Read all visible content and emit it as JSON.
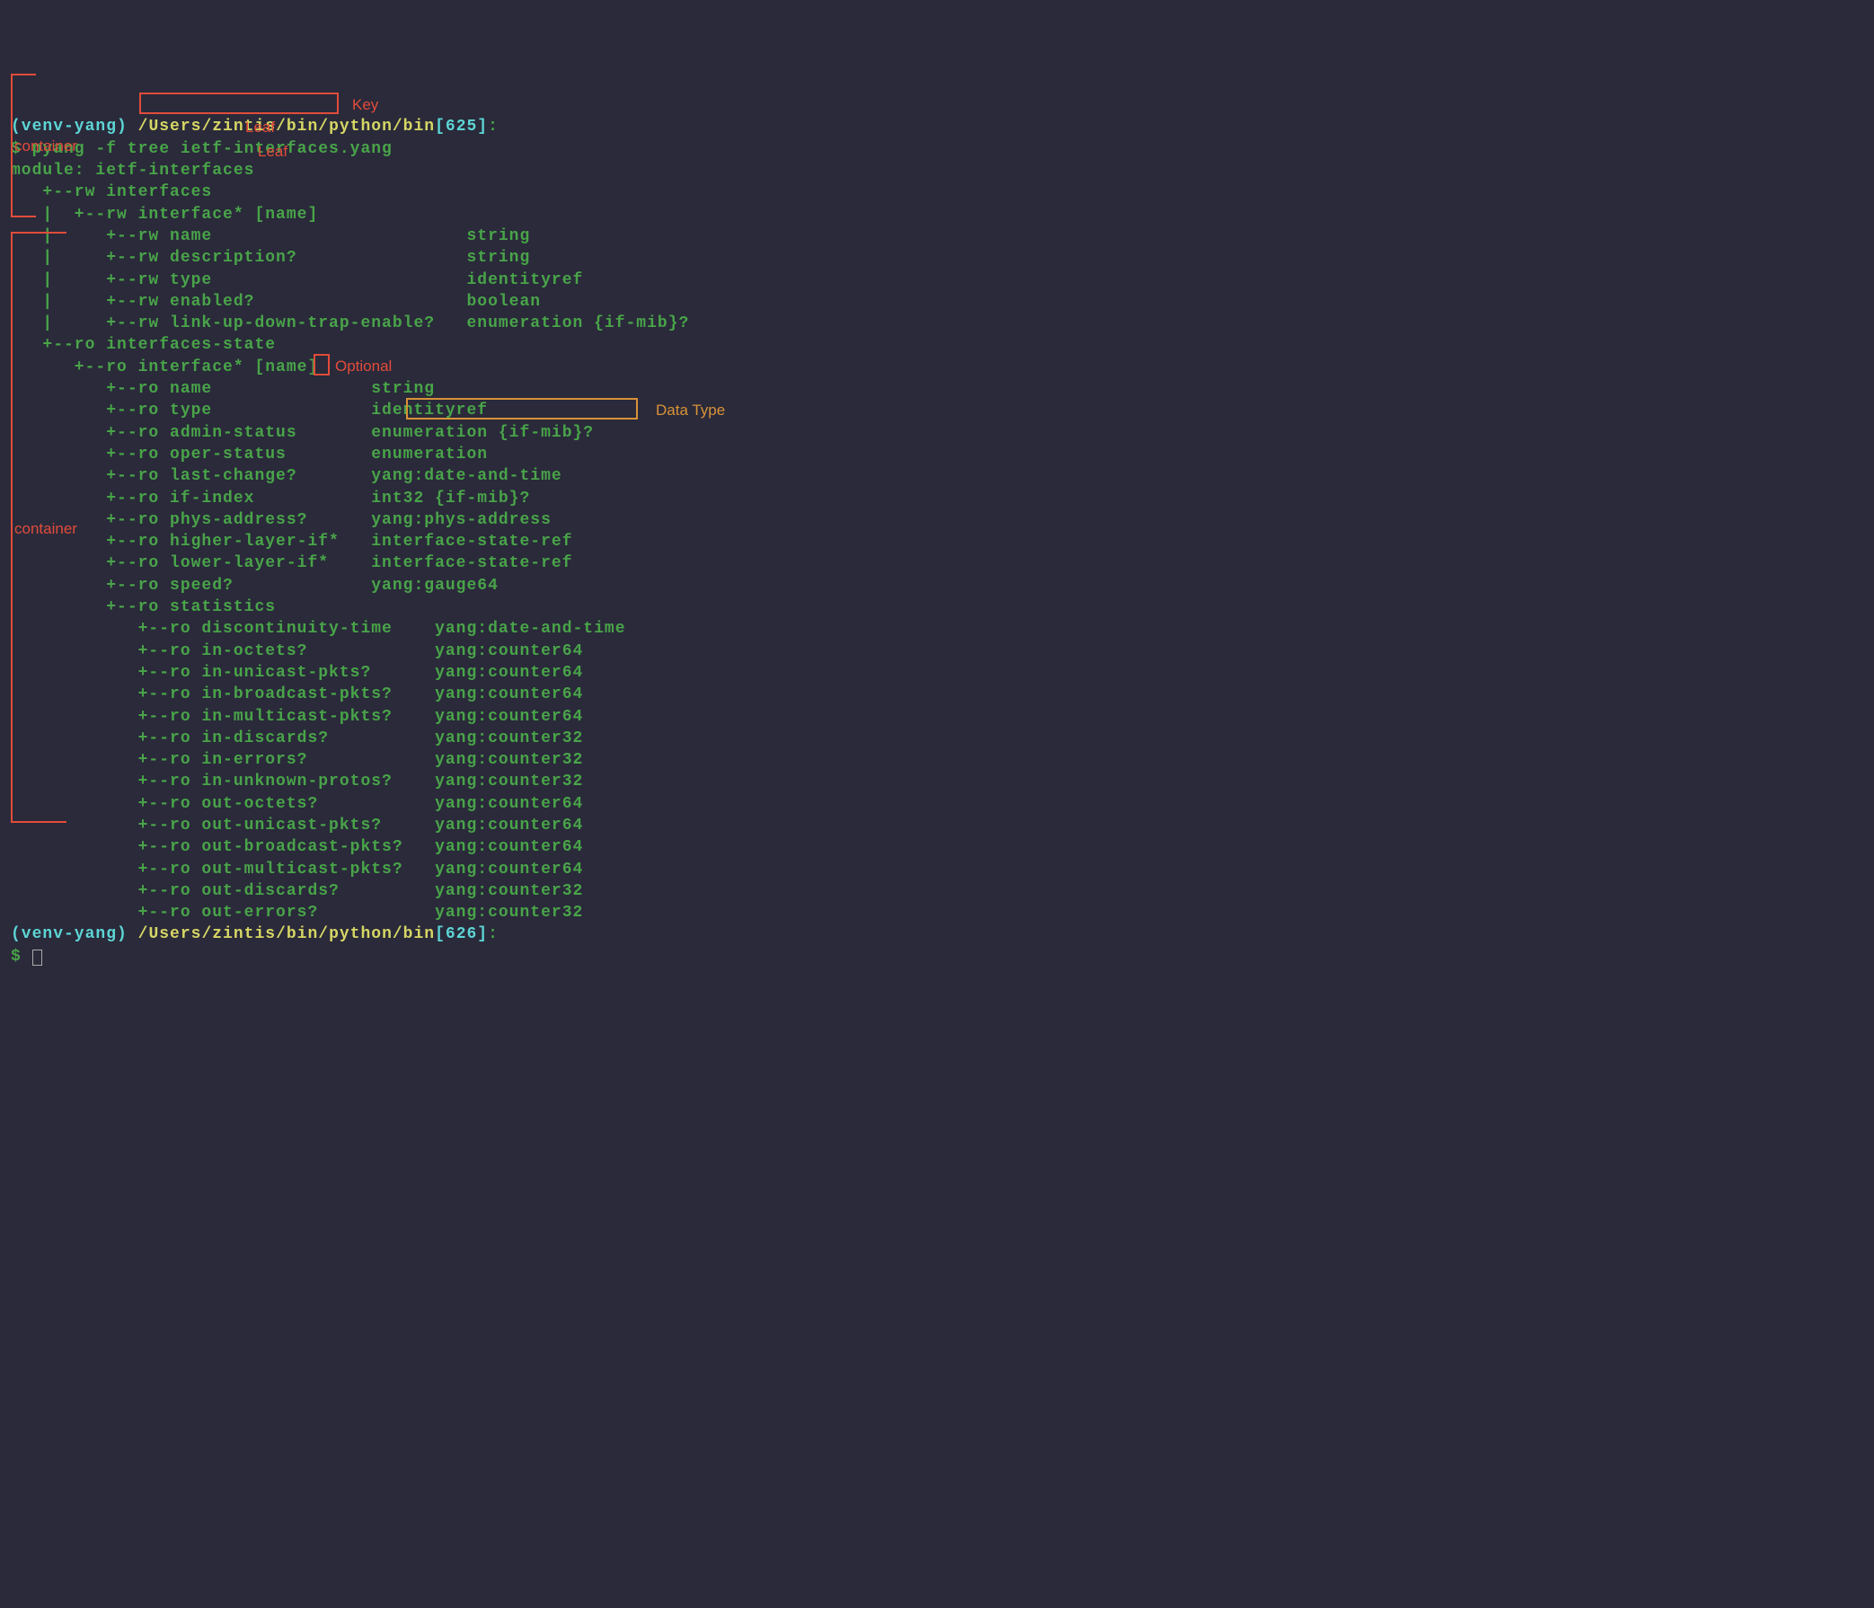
{
  "prompt1": {
    "venv": "(venv-yang)",
    "path": "/Users/zintis/bin/python/bin",
    "histnum": "[625]",
    "colon": ":"
  },
  "cmd1": "$ pyang -f tree ietf-interfaces.yang",
  "module_line": "module: ietf-interfaces",
  "tree1": {
    "l1": "   +--rw interfaces",
    "l2": "   |  +--rw interface* [name]",
    "l3": "   |     +--rw name                        string",
    "l4": "   |     +--rw description?                string",
    "l5": "   |     +--rw type                        identityref",
    "l6": "   |     +--rw enabled?                    boolean",
    "l7": "   |     +--rw link-up-down-trap-enable?   enumeration {if-mib}?"
  },
  "tree2": {
    "l1": "   +--ro interfaces-state",
    "l2": "      +--ro interface* [name]",
    "l3": "         +--ro name               string",
    "l4": "         +--ro type               identityref",
    "l5": "         +--ro admin-status       enumeration {if-mib}?",
    "l6": "         +--ro oper-status        enumeration",
    "l7": "         +--ro last-change?       yang:date-and-time",
    "l8": "         +--ro if-index           int32 {if-mib}?",
    "l9": "         +--ro phys-address?      yang:phys-address",
    "l10": "         +--ro higher-layer-if*   interface-state-ref",
    "l11": "         +--ro lower-layer-if*    interface-state-ref",
    "l12": "         +--ro speed?             yang:gauge64",
    "l13": "         +--ro statistics",
    "s1": "            +--ro discontinuity-time    yang:date-and-time",
    "s2": "            +--ro in-octets?            yang:counter64",
    "s3": "            +--ro in-unicast-pkts?      yang:counter64",
    "s4": "            +--ro in-broadcast-pkts?    yang:counter64",
    "s5": "            +--ro in-multicast-pkts?    yang:counter64",
    "s6": "            +--ro in-discards?          yang:counter32",
    "s7": "            +--ro in-errors?            yang:counter32",
    "s8": "            +--ro in-unknown-protos?    yang:counter32",
    "s9": "            +--ro out-octets?           yang:counter64",
    "s10": "            +--ro out-unicast-pkts?     yang:counter64",
    "s11": "            +--ro out-broadcast-pkts?   yang:counter64",
    "s12": "            +--ro out-multicast-pkts?   yang:counter64",
    "s13": "            +--ro out-discards?         yang:counter32",
    "s14": "            +--ro out-errors?           yang:counter32"
  },
  "prompt2": {
    "venv": "(venv-yang)",
    "path": "/Users/zintis/bin/python/bin",
    "histnum": "[626]",
    "colon": ":"
  },
  "cmd2": "$ ",
  "annotations": {
    "key": "Key",
    "leaf": "Leaf",
    "leaf2": "Leaf",
    "container1": "container",
    "container2": "container",
    "optional": "Optional",
    "datatype": "Data Type"
  }
}
